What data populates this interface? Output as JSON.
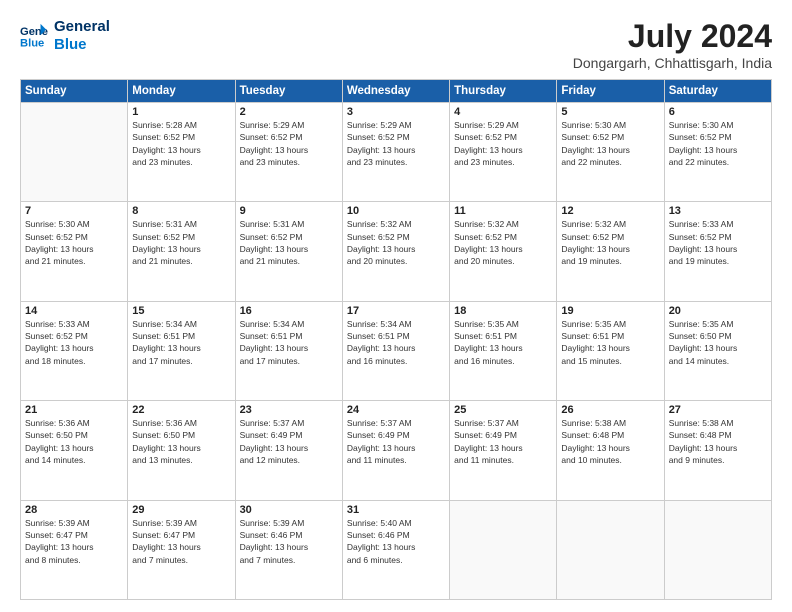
{
  "header": {
    "logo_line1": "General",
    "logo_line2": "Blue",
    "title": "July 2024",
    "subtitle": "Dongargarh, Chhattisgarh, India"
  },
  "weekdays": [
    "Sunday",
    "Monday",
    "Tuesday",
    "Wednesday",
    "Thursday",
    "Friday",
    "Saturday"
  ],
  "weeks": [
    [
      {
        "day": "",
        "sunrise": "",
        "sunset": "",
        "daylight": ""
      },
      {
        "day": "1",
        "sunrise": "Sunrise: 5:28 AM",
        "sunset": "Sunset: 6:52 PM",
        "daylight": "Daylight: 13 hours and 23 minutes."
      },
      {
        "day": "2",
        "sunrise": "Sunrise: 5:29 AM",
        "sunset": "Sunset: 6:52 PM",
        "daylight": "Daylight: 13 hours and 23 minutes."
      },
      {
        "day": "3",
        "sunrise": "Sunrise: 5:29 AM",
        "sunset": "Sunset: 6:52 PM",
        "daylight": "Daylight: 13 hours and 23 minutes."
      },
      {
        "day": "4",
        "sunrise": "Sunrise: 5:29 AM",
        "sunset": "Sunset: 6:52 PM",
        "daylight": "Daylight: 13 hours and 23 minutes."
      },
      {
        "day": "5",
        "sunrise": "Sunrise: 5:30 AM",
        "sunset": "Sunset: 6:52 PM",
        "daylight": "Daylight: 13 hours and 22 minutes."
      },
      {
        "day": "6",
        "sunrise": "Sunrise: 5:30 AM",
        "sunset": "Sunset: 6:52 PM",
        "daylight": "Daylight: 13 hours and 22 minutes."
      }
    ],
    [
      {
        "day": "7",
        "sunrise": "Sunrise: 5:30 AM",
        "sunset": "Sunset: 6:52 PM",
        "daylight": "Daylight: 13 hours and 21 minutes."
      },
      {
        "day": "8",
        "sunrise": "Sunrise: 5:31 AM",
        "sunset": "Sunset: 6:52 PM",
        "daylight": "Daylight: 13 hours and 21 minutes."
      },
      {
        "day": "9",
        "sunrise": "Sunrise: 5:31 AM",
        "sunset": "Sunset: 6:52 PM",
        "daylight": "Daylight: 13 hours and 21 minutes."
      },
      {
        "day": "10",
        "sunrise": "Sunrise: 5:32 AM",
        "sunset": "Sunset: 6:52 PM",
        "daylight": "Daylight: 13 hours and 20 minutes."
      },
      {
        "day": "11",
        "sunrise": "Sunrise: 5:32 AM",
        "sunset": "Sunset: 6:52 PM",
        "daylight": "Daylight: 13 hours and 20 minutes."
      },
      {
        "day": "12",
        "sunrise": "Sunrise: 5:32 AM",
        "sunset": "Sunset: 6:52 PM",
        "daylight": "Daylight: 13 hours and 19 minutes."
      },
      {
        "day": "13",
        "sunrise": "Sunrise: 5:33 AM",
        "sunset": "Sunset: 6:52 PM",
        "daylight": "Daylight: 13 hours and 19 minutes."
      }
    ],
    [
      {
        "day": "14",
        "sunrise": "Sunrise: 5:33 AM",
        "sunset": "Sunset: 6:52 PM",
        "daylight": "Daylight: 13 hours and 18 minutes."
      },
      {
        "day": "15",
        "sunrise": "Sunrise: 5:34 AM",
        "sunset": "Sunset: 6:51 PM",
        "daylight": "Daylight: 13 hours and 17 minutes."
      },
      {
        "day": "16",
        "sunrise": "Sunrise: 5:34 AM",
        "sunset": "Sunset: 6:51 PM",
        "daylight": "Daylight: 13 hours and 17 minutes."
      },
      {
        "day": "17",
        "sunrise": "Sunrise: 5:34 AM",
        "sunset": "Sunset: 6:51 PM",
        "daylight": "Daylight: 13 hours and 16 minutes."
      },
      {
        "day": "18",
        "sunrise": "Sunrise: 5:35 AM",
        "sunset": "Sunset: 6:51 PM",
        "daylight": "Daylight: 13 hours and 16 minutes."
      },
      {
        "day": "19",
        "sunrise": "Sunrise: 5:35 AM",
        "sunset": "Sunset: 6:51 PM",
        "daylight": "Daylight: 13 hours and 15 minutes."
      },
      {
        "day": "20",
        "sunrise": "Sunrise: 5:35 AM",
        "sunset": "Sunset: 6:50 PM",
        "daylight": "Daylight: 13 hours and 14 minutes."
      }
    ],
    [
      {
        "day": "21",
        "sunrise": "Sunrise: 5:36 AM",
        "sunset": "Sunset: 6:50 PM",
        "daylight": "Daylight: 13 hours and 14 minutes."
      },
      {
        "day": "22",
        "sunrise": "Sunrise: 5:36 AM",
        "sunset": "Sunset: 6:50 PM",
        "daylight": "Daylight: 13 hours and 13 minutes."
      },
      {
        "day": "23",
        "sunrise": "Sunrise: 5:37 AM",
        "sunset": "Sunset: 6:49 PM",
        "daylight": "Daylight: 13 hours and 12 minutes."
      },
      {
        "day": "24",
        "sunrise": "Sunrise: 5:37 AM",
        "sunset": "Sunset: 6:49 PM",
        "daylight": "Daylight: 13 hours and 11 minutes."
      },
      {
        "day": "25",
        "sunrise": "Sunrise: 5:37 AM",
        "sunset": "Sunset: 6:49 PM",
        "daylight": "Daylight: 13 hours and 11 minutes."
      },
      {
        "day": "26",
        "sunrise": "Sunrise: 5:38 AM",
        "sunset": "Sunset: 6:48 PM",
        "daylight": "Daylight: 13 hours and 10 minutes."
      },
      {
        "day": "27",
        "sunrise": "Sunrise: 5:38 AM",
        "sunset": "Sunset: 6:48 PM",
        "daylight": "Daylight: 13 hours and 9 minutes."
      }
    ],
    [
      {
        "day": "28",
        "sunrise": "Sunrise: 5:39 AM",
        "sunset": "Sunset: 6:47 PM",
        "daylight": "Daylight: 13 hours and 8 minutes."
      },
      {
        "day": "29",
        "sunrise": "Sunrise: 5:39 AM",
        "sunset": "Sunset: 6:47 PM",
        "daylight": "Daylight: 13 hours and 7 minutes."
      },
      {
        "day": "30",
        "sunrise": "Sunrise: 5:39 AM",
        "sunset": "Sunset: 6:46 PM",
        "daylight": "Daylight: 13 hours and 7 minutes."
      },
      {
        "day": "31",
        "sunrise": "Sunrise: 5:40 AM",
        "sunset": "Sunset: 6:46 PM",
        "daylight": "Daylight: 13 hours and 6 minutes."
      },
      {
        "day": "",
        "sunrise": "",
        "sunset": "",
        "daylight": ""
      },
      {
        "day": "",
        "sunrise": "",
        "sunset": "",
        "daylight": ""
      },
      {
        "day": "",
        "sunrise": "",
        "sunset": "",
        "daylight": ""
      }
    ]
  ]
}
